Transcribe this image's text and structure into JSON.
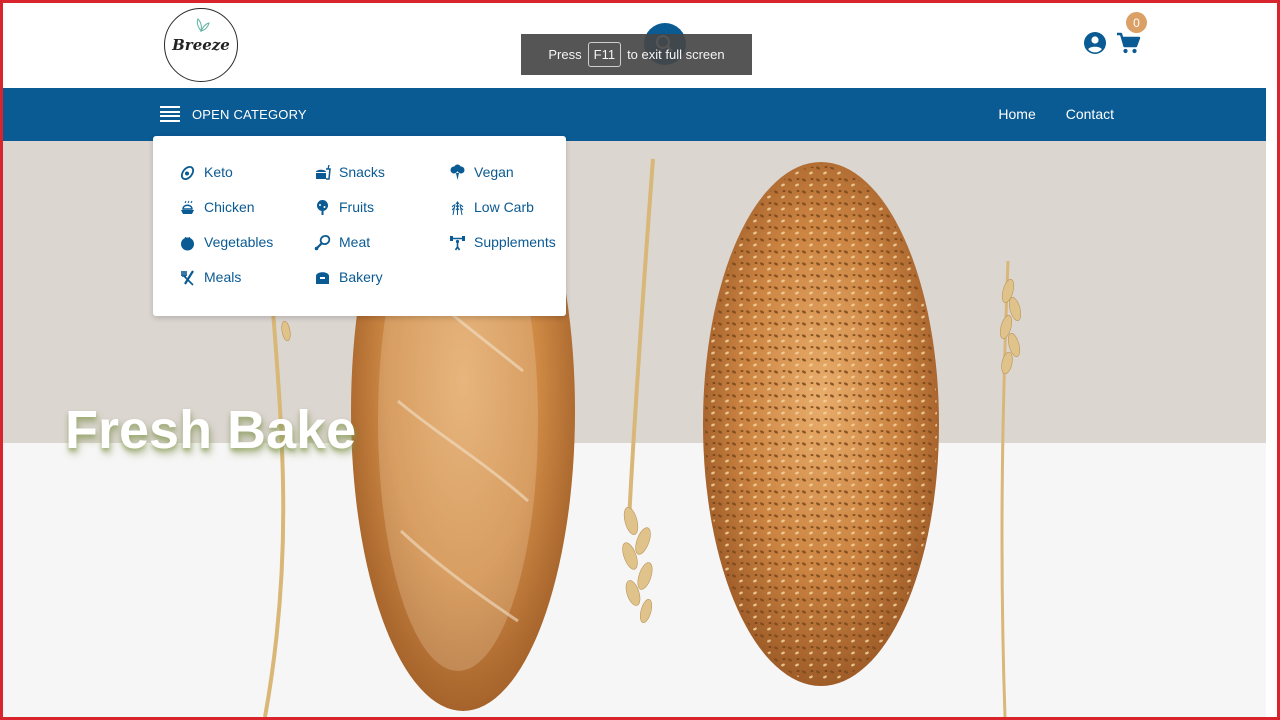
{
  "logo": {
    "text": "Breeze",
    "icon": "leaf-icon"
  },
  "fullscreen_toast": {
    "prefix": "Press",
    "key": "F11",
    "suffix": "to exit full screen"
  },
  "header": {
    "search_icon": "search-icon",
    "user_icon": "account-circle-icon",
    "cart_icon": "shopping-cart-icon",
    "cart_count": "0"
  },
  "nav": {
    "open_category_label": "OPEN CATEGORY",
    "links": [
      {
        "label": "Home"
      },
      {
        "label": "Contact"
      }
    ]
  },
  "categories": [
    {
      "label": "Keto",
      "icon": "avocado-icon"
    },
    {
      "label": "Snacks",
      "icon": "fast-food-icon"
    },
    {
      "label": "Vegan",
      "icon": "broccoli-icon"
    },
    {
      "label": "Chicken",
      "icon": "roast-chicken-icon"
    },
    {
      "label": "Fruits",
      "icon": "fruit-tree-icon"
    },
    {
      "label": "Low Carb",
      "icon": "wheat-icon"
    },
    {
      "label": "Vegetables",
      "icon": "tomato-icon"
    },
    {
      "label": "Meat",
      "icon": "drumstick-icon"
    },
    {
      "label": "Supplements",
      "icon": "dumbbell-person-icon"
    },
    {
      "label": "Meals",
      "icon": "fork-knife-icon"
    },
    {
      "label": "Bakery",
      "icon": "bread-icon"
    }
  ],
  "hero": {
    "title": "Fresh Bake"
  },
  "colors": {
    "brand_blue": "#0a5a93",
    "badge": "#dba066",
    "frame": "#d8252d"
  }
}
